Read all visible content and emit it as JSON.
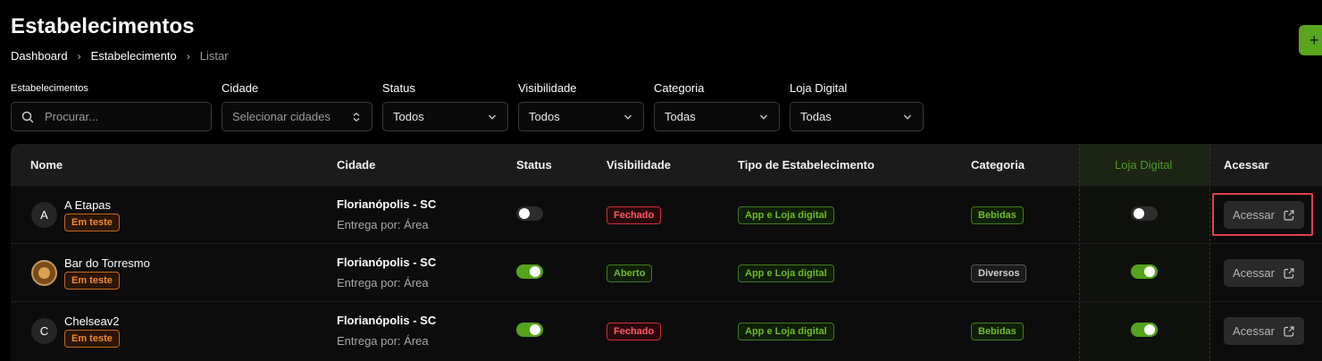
{
  "header": {
    "title": "Estabelecimentos",
    "add_label": "+"
  },
  "breadcrumb": [
    "Dashboard",
    "Estabelecimento",
    "Listar"
  ],
  "filters": {
    "estabelecimentos": {
      "label": "Estabelecimentos",
      "placeholder": "Procurar..."
    },
    "cidade": {
      "label": "Cidade",
      "value": "Selecionar cidades"
    },
    "status": {
      "label": "Status",
      "value": "Todos"
    },
    "visibilidade": {
      "label": "Visibilidade",
      "value": "Todos"
    },
    "categoria": {
      "label": "Categoria",
      "value": "Todas"
    },
    "loja_digital": {
      "label": "Loja Digital",
      "value": "Todas"
    }
  },
  "table": {
    "columns": [
      "Nome",
      "Cidade",
      "Status",
      "Visibilidade",
      "Tipo de Estabelecimento",
      "Categoria",
      "Loja Digital",
      "Acessar"
    ],
    "rows": [
      {
        "initial": "A",
        "name": "A Etapas",
        "tag": "Em teste",
        "city": "Florianópolis - SC",
        "entrega": "Entrega por: Área",
        "status_on": false,
        "visibilidade": "Fechado",
        "tipo": "App e Loja digital",
        "categoria": "Bebidas",
        "loja_on": false,
        "action": "Acessar"
      },
      {
        "initial": "",
        "name": "Bar do Torresmo",
        "tag": "Em teste",
        "city": "Florianópolis - SC",
        "entrega": "Entrega por: Área",
        "status_on": true,
        "visibilidade": "Aberto",
        "tipo": "App e Loja digital",
        "categoria": "Diversos",
        "loja_on": true,
        "action": "Acessar"
      },
      {
        "initial": "C",
        "name": "Chelseav2",
        "tag": "Em teste",
        "city": "Florianópolis - SC",
        "entrega": "Entrega por: Área",
        "status_on": true,
        "visibilidade": "Fechado",
        "tipo": "App e Loja digital",
        "categoria": "Bebidas",
        "loja_on": true,
        "action": "Acessar"
      }
    ]
  },
  "colors": {
    "accent": "#54a31d",
    "danger": "#ff5a63",
    "warning": "#f08a2a"
  }
}
